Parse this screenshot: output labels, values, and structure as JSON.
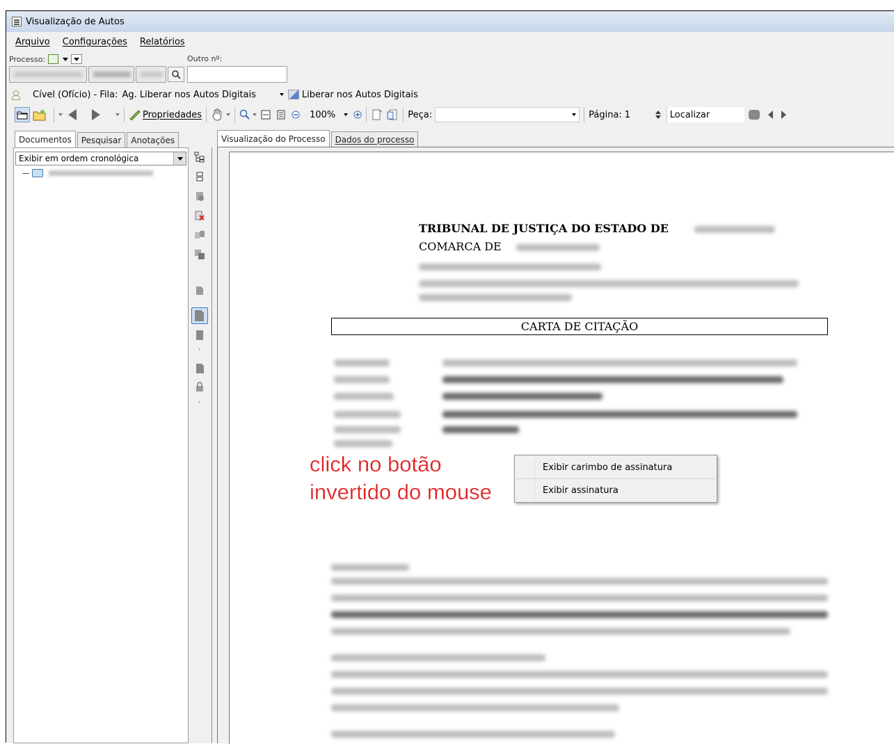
{
  "window": {
    "title": "Visualização de Autos"
  },
  "menu": {
    "items": [
      "Arquivo",
      "Configurações",
      "Relatórios"
    ]
  },
  "process": {
    "label": "Processo:",
    "other_label": "Outro nº:",
    "other_value": ""
  },
  "fila": {
    "area": "Cível (Ofício) - Fila:",
    "queue": "Ag. Liberar nos Autos Digitais",
    "action": "Liberar nos Autos Digitais"
  },
  "toolbar": {
    "properties_label": "Propriedades",
    "zoom_value": "100%",
    "piece_label": "Peça:",
    "piece_value": "",
    "page_label": "Página:",
    "page_value": "1",
    "find_label": "Localizar"
  },
  "left_tabs": [
    "Documentos",
    "Pesquisar",
    "Anotações"
  ],
  "right_tabs": [
    "Visualização do Processo",
    "Dados do processo"
  ],
  "left_panel": {
    "order_option": "Exibir em ordem cronológica"
  },
  "document": {
    "court_header": "TRIBUNAL DE JUSTIÇA DO ESTADO DE",
    "comarca": "COMARCA DE",
    "title": "CARTA DE CITAÇÃO"
  },
  "annotation": {
    "line1": "click no botão",
    "line2": "invertido do mouse",
    "color": "#e02020"
  },
  "context_menu": {
    "items": [
      "Exibir carimbo de assinatura",
      "Exibir assinatura"
    ]
  },
  "icons": [
    "app-icon",
    "search-icon",
    "people-icon",
    "gear-icon",
    "folder-icon",
    "hand-icon",
    "zoom-icon",
    "binoculars-icon"
  ]
}
